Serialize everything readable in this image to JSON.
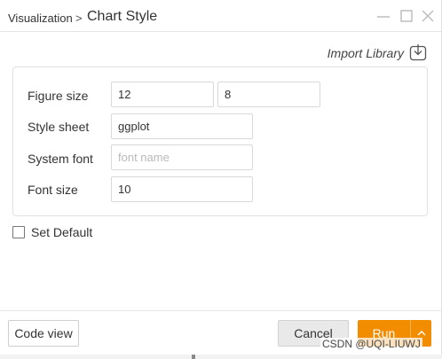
{
  "titlebar": {
    "breadcrumb": "Visualization",
    "separator": ">",
    "title": "Chart Style",
    "icons": [
      "minimize-icon",
      "maximize-icon",
      "close-icon"
    ]
  },
  "import_library": {
    "label": "Import Library",
    "icon": "import-icon"
  },
  "form": {
    "figure_size": {
      "label": "Figure size",
      "width": "12",
      "height": "8"
    },
    "style_sheet": {
      "label": "Style sheet",
      "value": "ggplot"
    },
    "system_font": {
      "label": "System font",
      "value": "",
      "placeholder": "font name"
    },
    "font_size": {
      "label": "Font size",
      "value": "10"
    }
  },
  "set_default": {
    "label": "Set Default",
    "checked": false
  },
  "footer": {
    "code_view_label": "Code view",
    "cancel_label": "Cancel",
    "run_label": "Run",
    "run_menu_icon": "chevron-up-icon"
  },
  "watermark": "CSDN @UQI-LIUWJ",
  "colors": {
    "run_button": "#f28c00"
  }
}
